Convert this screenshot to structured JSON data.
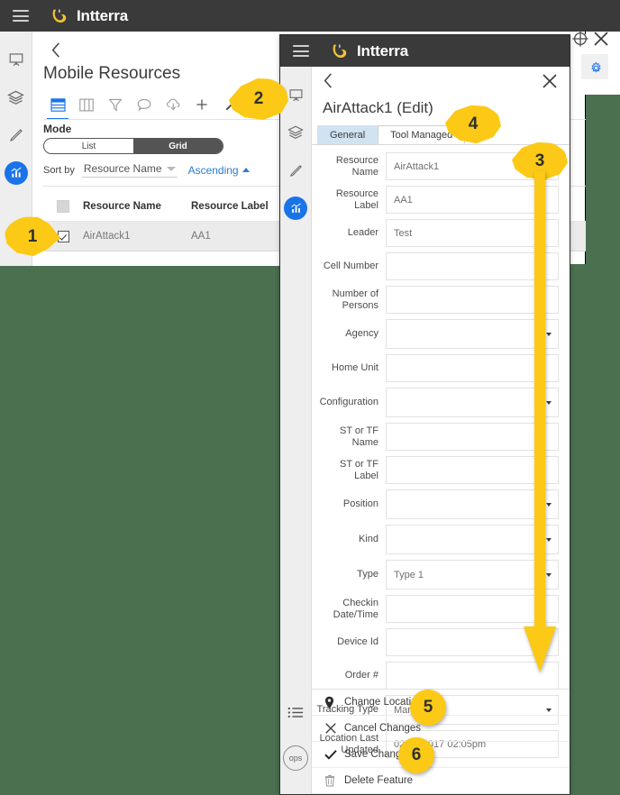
{
  "app": {
    "brand": "Intterra",
    "menu_icon": "hamburger-icon"
  },
  "left_panel": {
    "back_icon": "chevron-left-icon",
    "title": "Mobile Resources",
    "toolbar": [
      {
        "name": "table-view-icon",
        "label": "Table View",
        "selected": true
      },
      {
        "name": "columns-icon",
        "label": "Columns",
        "selected": false
      },
      {
        "name": "filter-icon",
        "label": "Filter",
        "selected": false
      },
      {
        "name": "comment-icon",
        "label": "Comment",
        "selected": false
      },
      {
        "name": "cloud-download-icon",
        "label": "Download",
        "selected": false
      },
      {
        "name": "plus-icon",
        "label": "Add",
        "selected": false
      },
      {
        "name": "pencil-icon",
        "label": "Edit",
        "selected": false
      }
    ],
    "mode_label": "Mode",
    "mode_options": [
      "List",
      "Grid"
    ],
    "mode_selected": "Grid",
    "sort_by_label": "Sort by",
    "sort_by_value": "Resource Name",
    "sort_direction": "Ascending",
    "table": {
      "columns": [
        "Resource Name",
        "Resource Label"
      ],
      "rows": [
        {
          "checked": true,
          "resource_name": "AirAttack1",
          "resource_label": "AA1"
        }
      ]
    }
  },
  "modal": {
    "brand": "Intterra",
    "back_icon": "chevron-left-icon",
    "close_icon": "close-icon",
    "title": "AirAttack1 (Edit)",
    "tabs": [
      {
        "label": "General",
        "active": true
      },
      {
        "label": "Tool Managed",
        "active": false
      }
    ],
    "fields": [
      {
        "label": "Resource Name",
        "value": "AirAttack1",
        "type": "text"
      },
      {
        "label": "Resource Label",
        "value": "AA1",
        "type": "text"
      },
      {
        "label": "Leader",
        "value": "Test",
        "type": "text"
      },
      {
        "label": "Cell Number",
        "value": "",
        "type": "text"
      },
      {
        "label": "Number of Persons",
        "value": "",
        "type": "text"
      },
      {
        "label": "Agency",
        "value": "",
        "type": "select"
      },
      {
        "label": "Home Unit",
        "value": "",
        "type": "text"
      },
      {
        "label": "Configuration",
        "value": "",
        "type": "select"
      },
      {
        "label": "ST or TF Name",
        "value": "",
        "type": "text"
      },
      {
        "label": "ST or TF Label",
        "value": "",
        "type": "text"
      },
      {
        "label": "Position",
        "value": "",
        "type": "select"
      },
      {
        "label": "Kind",
        "value": "",
        "type": "select"
      },
      {
        "label": "Type",
        "value": "Type 1",
        "type": "select"
      },
      {
        "label": "Checkin Date/Time",
        "value": "",
        "type": "text"
      },
      {
        "label": "Device Id",
        "value": "",
        "type": "text"
      },
      {
        "label": "Order #",
        "value": "",
        "type": "text"
      },
      {
        "label": "Tracking Type",
        "value": "Manual",
        "type": "select"
      },
      {
        "label": "Location Last Updated",
        "value": "02-15-2017 02:05pm",
        "type": "text"
      }
    ],
    "actions": [
      {
        "label": "Change Location",
        "icon": "map-pin-icon"
      },
      {
        "label": "Cancel Changes",
        "icon": "close-icon"
      },
      {
        "label": "Save Changes",
        "icon": "check-icon"
      },
      {
        "label": "Delete Feature",
        "icon": "trash-icon"
      }
    ],
    "rail_bottom": [
      {
        "name": "list-icon",
        "label": "List"
      },
      {
        "name": "ops-badge",
        "label": "ops"
      }
    ]
  },
  "rail_icons": [
    {
      "name": "presentation-icon",
      "label": "Dashboard"
    },
    {
      "name": "layers-icon",
      "label": "Layers"
    },
    {
      "name": "pencil-icon",
      "label": "Draw"
    },
    {
      "name": "analytics-icon",
      "label": "Analytics",
      "active": true
    }
  ],
  "overlay_icons": [
    {
      "name": "crosshair-icon",
      "label": "Locate"
    },
    {
      "name": "close-icon",
      "label": "Close"
    },
    {
      "name": "gear-icon",
      "label": "Settings"
    }
  ],
  "callouts": [
    {
      "id": "1",
      "label": "1"
    },
    {
      "id": "2",
      "label": "2"
    },
    {
      "id": "3",
      "label": "3"
    },
    {
      "id": "4",
      "label": "4"
    },
    {
      "id": "5",
      "label": "5"
    },
    {
      "id": "6",
      "label": "6"
    }
  ],
  "colors": {
    "header_bg": "#3a3a3a",
    "accent_blue": "#1a73e8",
    "callout_yellow": "#fbc916",
    "map_green": "#4a7050",
    "tab_active": "#cfe3f3"
  }
}
